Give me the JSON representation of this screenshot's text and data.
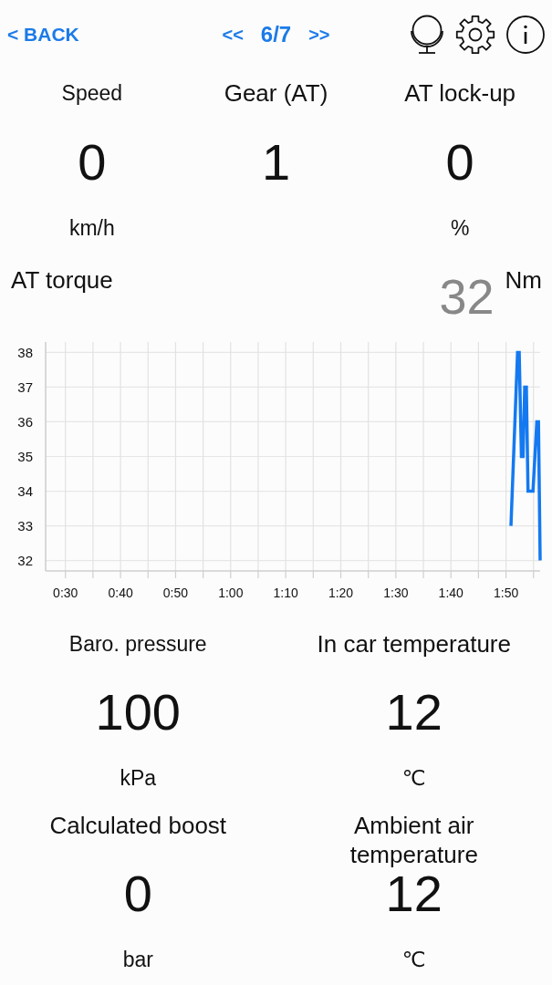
{
  "header": {
    "back_link": "< BACK",
    "pager": {
      "previous": "<<",
      "page": "6/7",
      "next": ">>"
    }
  },
  "top_metrics": [
    {
      "label": "Speed",
      "value": "0",
      "unit": "km/h"
    },
    {
      "label": "Gear (AT)",
      "value": "1"
    },
    {
      "label": "AT lock-up",
      "value": "0",
      "unit": "%"
    }
  ],
  "torque": {
    "label": "AT torque",
    "value": "32",
    "unit": "Nm",
    "chart_data": {
      "type": "line",
      "grid": true,
      "x": [
        110.9,
        112.1,
        112.4,
        112.8,
        113.1,
        113.4,
        113.7,
        114.0,
        114.9,
        115.6,
        115.9,
        116.2
      ],
      "series": [
        {
          "color": "#1479f0",
          "values": [
            33,
            38,
            38,
            35,
            35,
            37,
            37,
            34,
            34,
            36,
            36,
            32
          ]
        }
      ],
      "xlim": [
        26.4,
        116.2
      ],
      "ylim": [
        31.7,
        38.3
      ],
      "xticks": [
        {
          "value": 30,
          "label": "0:30"
        },
        {
          "value": 40,
          "label": "0:40"
        },
        {
          "value": 50,
          "label": "0:50"
        },
        {
          "value": 60,
          "label": "1:00"
        },
        {
          "value": 70,
          "label": "1:10"
        },
        {
          "value": 80,
          "label": "1:20"
        },
        {
          "value": 90,
          "label": "1:30"
        },
        {
          "value": 100,
          "label": "1:40"
        },
        {
          "value": 110,
          "label": "1:50"
        }
      ],
      "yticks": [
        32,
        33,
        34,
        35,
        36,
        37,
        38
      ]
    }
  },
  "bottom_metrics": [
    {
      "label": "Baro. pressure",
      "value": "100",
      "unit": "kPa"
    },
    {
      "label": "In car temperature",
      "value": "12",
      "unit": "℃"
    },
    {
      "label": "Calculated boost",
      "value": "0",
      "unit": "bar"
    },
    {
      "label": "Ambient air temperature",
      "value": "12",
      "unit": "℃"
    }
  ]
}
